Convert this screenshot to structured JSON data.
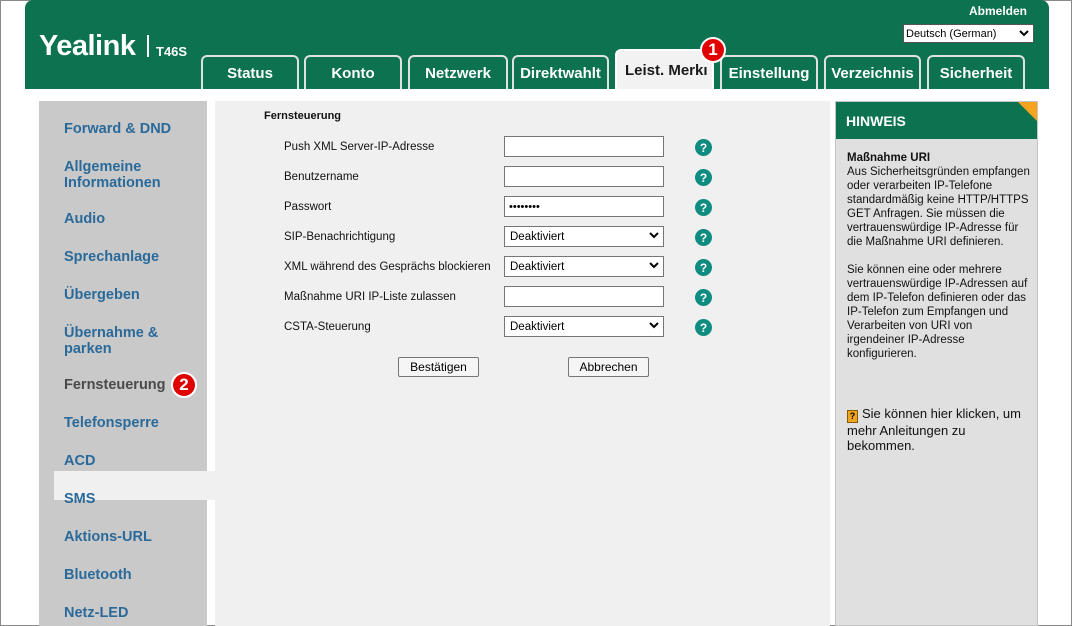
{
  "header": {
    "logo": "Yealink",
    "model": "T46S",
    "logout": "Abmelden",
    "language": "Deutsch (German)"
  },
  "tabs": [
    {
      "label": "Status"
    },
    {
      "label": "Konto"
    },
    {
      "label": "Netzwerk"
    },
    {
      "label": "Direktwahlt"
    },
    {
      "label": "Leist. Merkı"
    },
    {
      "label": "Einstellung"
    },
    {
      "label": "Verzeichnis"
    },
    {
      "label": "Sicherheit"
    }
  ],
  "badges": [
    "1",
    "2"
  ],
  "sidebar": {
    "items": [
      {
        "label": "Forward & DND"
      },
      {
        "label": "Allgemeine Informationen"
      },
      {
        "label": "Audio"
      },
      {
        "label": "Sprechanlage"
      },
      {
        "label": "Übergeben"
      },
      {
        "label": "Übernahme & parken"
      },
      {
        "label": "Fernsteuerung"
      },
      {
        "label": "Telefonsperre"
      },
      {
        "label": "ACD"
      },
      {
        "label": "SMS"
      },
      {
        "label": "Aktions-URL"
      },
      {
        "label": "Bluetooth"
      },
      {
        "label": "Netz-LED"
      }
    ]
  },
  "form": {
    "title": "Fernsteuerung",
    "fields": [
      {
        "label": "Push XML Server-IP-Adresse",
        "value": ""
      },
      {
        "label": "Benutzername",
        "value": ""
      },
      {
        "label": "Passwort",
        "value": "••••••••"
      },
      {
        "label": "SIP-Benachrichtigung",
        "value": "Deaktiviert"
      },
      {
        "label": "XML während des Gesprächs blockieren",
        "value": "Deaktiviert"
      },
      {
        "label": "Maßnahme URI IP-Liste zulassen",
        "value": ""
      },
      {
        "label": "CSTA-Steuerung",
        "value": "Deaktiviert"
      }
    ],
    "help_glyph": "?",
    "confirm": "Bestätigen",
    "cancel": "Abbrechen"
  },
  "hint": {
    "title": "HINWEIS",
    "subtitle": "Maßnahme URI",
    "p1": "Aus Sicherheitsgründen empfangen oder verarbeiten IP-Telefone standardmäßig keine HTTP/HTTPS GET Anfragen. Sie müssen die vertrauenswürdige IP-Adresse für die Maßnahme URI definieren.",
    "p2": "Sie können eine oder mehrere vertrauenswürdige IP-Adressen auf dem IP-Telefon definieren oder das IP-Telefon zum Empfangen und Verarbeiten von URI von irgendeiner IP-Adresse konfigurieren.",
    "link": "Sie können hier klicken, um mehr Anleitungen zu bekommen.",
    "book_glyph": "?"
  },
  "colors": {
    "brand_green": "#0d7250",
    "sidebar_link": "#2a6a9a",
    "badge_red": "#e00000",
    "help_teal": "#0f8c80",
    "hint_fold": "#f6a320"
  }
}
